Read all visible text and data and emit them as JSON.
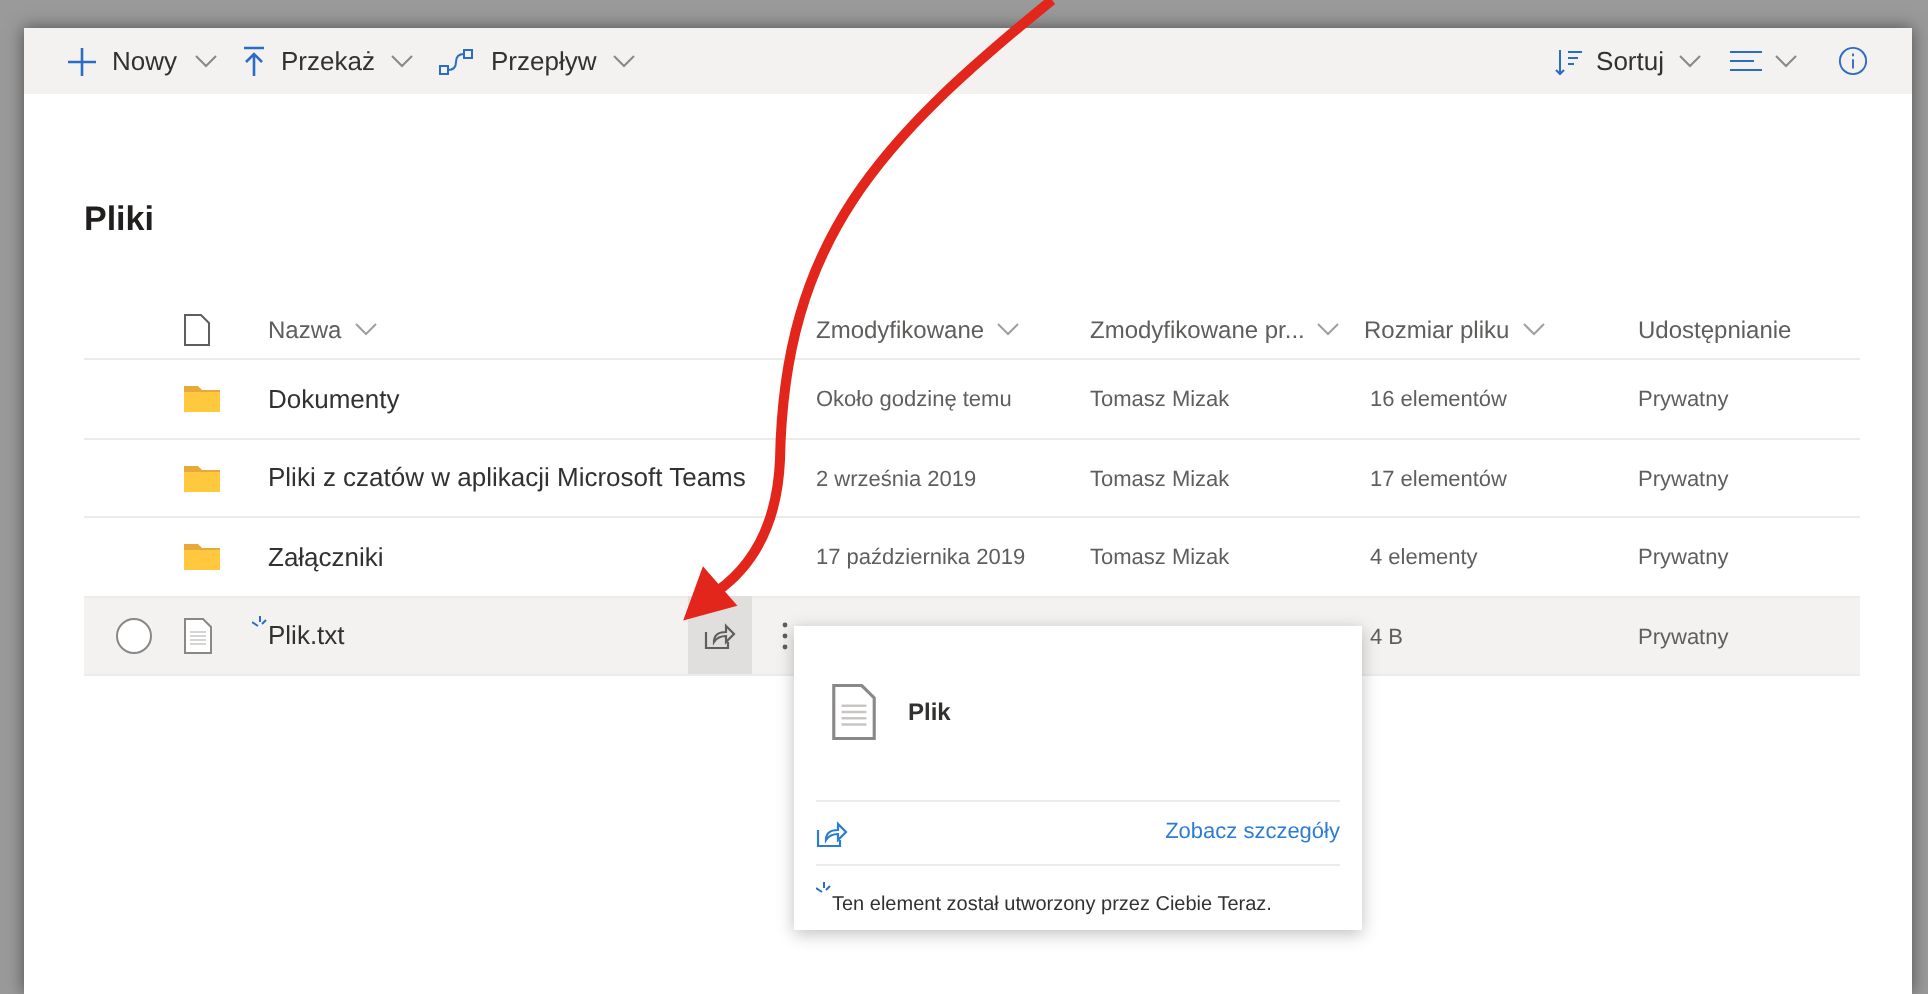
{
  "toolbar": {
    "left": [
      {
        "kind": "plus",
        "label": "Nowy"
      },
      {
        "kind": "upload",
        "label": "Przekaż"
      },
      {
        "kind": "flow",
        "label": "Przepływ"
      }
    ],
    "sort": {
      "label": "Sortuj"
    }
  },
  "title": "Pliki",
  "table": {
    "columns": [
      {
        "label": "Nazwa",
        "sortable": true
      },
      {
        "label": "Zmodyfikowane",
        "sortable": true
      },
      {
        "label": "Zmodyfikowane pr...",
        "sortable": true
      },
      {
        "label": "Rozmiar pliku",
        "sortable": true
      },
      {
        "label": "Udostępnianie",
        "sortable": false
      }
    ],
    "rows": [
      {
        "kind": "folder",
        "selected": false,
        "name": "Dokumenty",
        "modified": "Około godzinę temu",
        "modified_by": "Tomasz Mizak",
        "size": "16 elementów",
        "sharing": "Prywatny"
      },
      {
        "kind": "folder",
        "selected": false,
        "name": "Pliki z czatów w aplikacji Microsoft Teams",
        "modified": "2 września 2019",
        "modified_by": "Tomasz Mizak",
        "size": "17 elementów",
        "sharing": "Prywatny"
      },
      {
        "kind": "folder",
        "selected": false,
        "name": "Załączniki",
        "modified": "17 października 2019",
        "modified_by": "Tomasz Mizak",
        "size": "4 elementy",
        "sharing": "Prywatny"
      },
      {
        "kind": "file",
        "selected": true,
        "new": true,
        "name": "Plik.txt",
        "size": "4 B",
        "sharing": "Prywatny"
      }
    ]
  },
  "card": {
    "title": "Plik",
    "link": "Zobacz szczegóły",
    "note": "Ten element został utworzony przez Ciebie Teraz."
  }
}
